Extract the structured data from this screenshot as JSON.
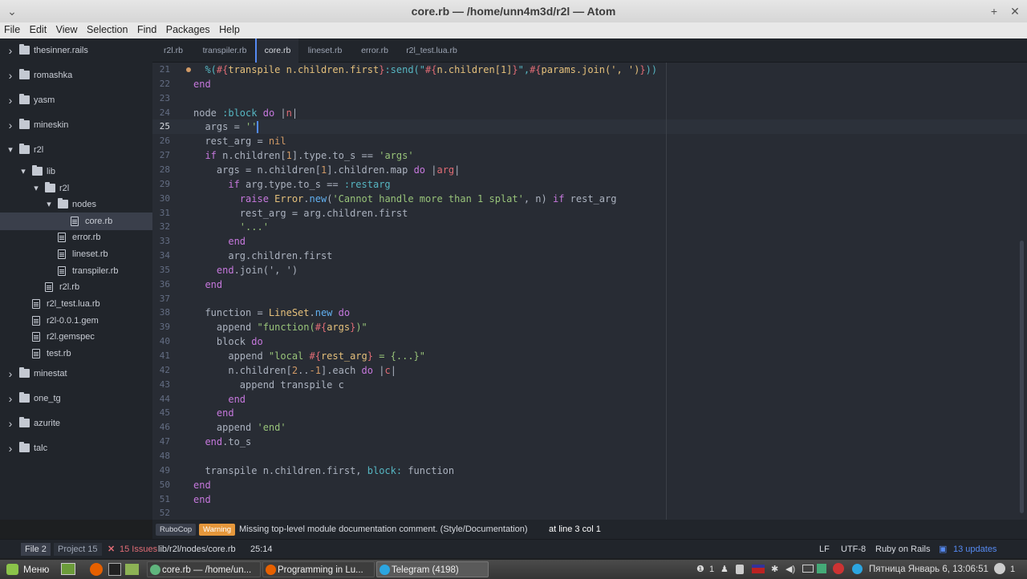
{
  "window": {
    "title": "core.rb — /home/unn4m3d/r2l — Atom",
    "add": "+",
    "close": "✕"
  },
  "menu": [
    "File",
    "Edit",
    "View",
    "Selection",
    "Find",
    "Packages",
    "Help"
  ],
  "tree": [
    {
      "label": "thesinner.rails",
      "type": "folder",
      "open": false
    },
    {
      "label": "romashka",
      "type": "folder",
      "open": false
    },
    {
      "label": "yasm",
      "type": "folder",
      "open": false
    },
    {
      "label": "mineskin",
      "type": "folder",
      "open": false
    },
    {
      "label": "r2l",
      "type": "folder",
      "open": true
    },
    {
      "label": "lib",
      "type": "folder",
      "open": true
    },
    {
      "label": "r2l",
      "type": "folder",
      "open": true
    },
    {
      "label": "nodes",
      "type": "folder",
      "open": true
    },
    {
      "label": "core.rb",
      "type": "file",
      "selected": true
    },
    {
      "label": "error.rb",
      "type": "file"
    },
    {
      "label": "lineset.rb",
      "type": "file"
    },
    {
      "label": "transpiler.rb",
      "type": "file"
    },
    {
      "label": "r2l.rb",
      "type": "file"
    },
    {
      "label": "r2l_test.lua.rb",
      "type": "file"
    },
    {
      "label": "r2l-0.0.1.gem",
      "type": "file"
    },
    {
      "label": "r2l.gemspec",
      "type": "file"
    },
    {
      "label": "test.rb",
      "type": "file"
    },
    {
      "label": "minestat",
      "type": "folder",
      "open": false
    },
    {
      "label": "one_tg",
      "type": "folder",
      "open": false
    },
    {
      "label": "azurite",
      "type": "folder",
      "open": false
    },
    {
      "label": "talc",
      "type": "folder",
      "open": false
    }
  ],
  "tabs": [
    {
      "label": "r2l.rb",
      "active": false
    },
    {
      "label": "transpiler.rb",
      "active": false
    },
    {
      "label": "core.rb",
      "active": true
    },
    {
      "label": "lineset.rb",
      "active": false
    },
    {
      "label": "error.rb",
      "active": false
    },
    {
      "label": "r2l_test.lua.rb",
      "active": false
    }
  ],
  "editor": {
    "current_line": 25,
    "lines": [
      {
        "n": "21",
        "marker": true,
        "t": [
          [
            "  %(",
            "y"
          ],
          [
            "#{",
            "r"
          ],
          [
            "transpile n.children.first",
            "c"
          ],
          [
            "}",
            "r"
          ],
          [
            ":send(\"",
            "y"
          ],
          [
            "#{",
            "r"
          ],
          [
            "n.children[1]",
            "c"
          ],
          [
            "}",
            "r"
          ],
          [
            "\",",
            "y"
          ],
          [
            "#{",
            "r"
          ],
          [
            "params.join(', ')",
            "c"
          ],
          [
            "}",
            "r"
          ],
          [
            "))",
            "y"
          ]
        ]
      },
      {
        "n": "22",
        "t": [
          [
            "end",
            "k"
          ]
        ]
      },
      {
        "n": "23",
        "t": []
      },
      {
        "n": "24",
        "t": [
          [
            "node ",
            ""
          ],
          [
            ":block",
            "y"
          ],
          [
            " ",
            ""
          ],
          [
            "do",
            "k"
          ],
          [
            " |",
            ""
          ],
          [
            "n",
            "r"
          ],
          [
            "|",
            ""
          ]
        ]
      },
      {
        "n": "25",
        "t": [
          [
            "  args = ",
            ""
          ],
          [
            "''",
            "s"
          ]
        ]
      },
      {
        "n": "26",
        "t": [
          [
            "  rest_arg = ",
            ""
          ],
          [
            "nil",
            "n"
          ]
        ]
      },
      {
        "n": "27",
        "t": [
          [
            "  ",
            ""
          ],
          [
            "if",
            "k"
          ],
          [
            " n.children[",
            ""
          ],
          [
            "1",
            "n"
          ],
          [
            "].type.to_s == ",
            ""
          ],
          [
            "'args'",
            "s"
          ]
        ]
      },
      {
        "n": "28",
        "t": [
          [
            "    args = n.children[",
            ""
          ],
          [
            "1",
            "n"
          ],
          [
            "].children.map ",
            ""
          ],
          [
            "do",
            "k"
          ],
          [
            " |",
            ""
          ],
          [
            "arg",
            "r"
          ],
          [
            "|",
            ""
          ]
        ]
      },
      {
        "n": "29",
        "t": [
          [
            "      ",
            ""
          ],
          [
            "if",
            "k"
          ],
          [
            " arg.type.to_s == ",
            ""
          ],
          [
            ":restarg",
            "y"
          ]
        ]
      },
      {
        "n": "30",
        "t": [
          [
            "        ",
            ""
          ],
          [
            "raise",
            "k"
          ],
          [
            " ",
            ""
          ],
          [
            "Error",
            "c"
          ],
          [
            ".",
            ""
          ],
          [
            "new",
            "f"
          ],
          [
            "(",
            ""
          ],
          [
            "'Cannot handle more than 1 splat'",
            "s"
          ],
          [
            ", n) ",
            ""
          ],
          [
            "if",
            "k"
          ],
          [
            " rest_arg",
            ""
          ]
        ]
      },
      {
        "n": "31",
        "t": [
          [
            "        rest_arg = arg.children.first",
            ""
          ]
        ]
      },
      {
        "n": "32",
        "t": [
          [
            "        ",
            ""
          ],
          [
            "'...'",
            "s"
          ]
        ]
      },
      {
        "n": "33",
        "t": [
          [
            "      ",
            ""
          ],
          [
            "end",
            "k"
          ]
        ]
      },
      {
        "n": "34",
        "t": [
          [
            "      arg.children.first",
            ""
          ]
        ]
      },
      {
        "n": "35",
        "t": [
          [
            "    ",
            ""
          ],
          [
            "end",
            "k"
          ],
          [
            ".join(', ')",
            ""
          ]
        ]
      },
      {
        "n": "36",
        "t": [
          [
            "  ",
            ""
          ],
          [
            "end",
            "k"
          ]
        ]
      },
      {
        "n": "37",
        "t": []
      },
      {
        "n": "38",
        "t": [
          [
            "  function = ",
            ""
          ],
          [
            "LineSet",
            "c"
          ],
          [
            ".",
            ""
          ],
          [
            "new",
            "f"
          ],
          [
            " ",
            ""
          ],
          [
            "do",
            "k"
          ]
        ]
      },
      {
        "n": "39",
        "t": [
          [
            "    append ",
            ""
          ],
          [
            "\"function(",
            "s"
          ],
          [
            "#{",
            "r"
          ],
          [
            "args",
            "c"
          ],
          [
            "}",
            "r"
          ],
          [
            ")\"",
            "s"
          ]
        ]
      },
      {
        "n": "40",
        "t": [
          [
            "    block ",
            ""
          ],
          [
            "do",
            "k"
          ]
        ]
      },
      {
        "n": "41",
        "t": [
          [
            "      append ",
            ""
          ],
          [
            "\"local ",
            "s"
          ],
          [
            "#{",
            "r"
          ],
          [
            "rest_arg",
            "c"
          ],
          [
            "}",
            "r"
          ],
          [
            " = {...}\"",
            "s"
          ]
        ]
      },
      {
        "n": "42",
        "t": [
          [
            "      n.children[",
            ""
          ],
          [
            "2",
            "n"
          ],
          [
            "..",
            ""
          ],
          [
            "-1",
            "n"
          ],
          [
            "].each ",
            ""
          ],
          [
            "do",
            "k"
          ],
          [
            " |",
            ""
          ],
          [
            "c",
            "r"
          ],
          [
            "|",
            ""
          ]
        ]
      },
      {
        "n": "43",
        "t": [
          [
            "        append transpile c",
            ""
          ]
        ]
      },
      {
        "n": "44",
        "t": [
          [
            "      ",
            ""
          ],
          [
            "end",
            "k"
          ]
        ]
      },
      {
        "n": "45",
        "t": [
          [
            "    ",
            ""
          ],
          [
            "end",
            "k"
          ]
        ]
      },
      {
        "n": "46",
        "t": [
          [
            "    append ",
            ""
          ],
          [
            "'end'",
            "s"
          ]
        ]
      },
      {
        "n": "47",
        "t": [
          [
            "  ",
            ""
          ],
          [
            "end",
            "k"
          ],
          [
            ".to_s",
            ""
          ]
        ]
      },
      {
        "n": "48",
        "t": []
      },
      {
        "n": "49",
        "t": [
          [
            "  transpile n.children.first, ",
            ""
          ],
          [
            "block:",
            "y"
          ],
          [
            " function",
            ""
          ]
        ]
      },
      {
        "n": "50",
        "t": [
          [
            "end",
            "k"
          ]
        ]
      },
      {
        "n": "51",
        "t": [
          [
            "end",
            "k"
          ]
        ]
      },
      {
        "n": "52",
        "t": []
      }
    ]
  },
  "lint": {
    "source": "RuboCop",
    "level": "Warning",
    "message": "Missing top-level module documentation comment. (Style/Documentation)",
    "location": "at line 3 col 1"
  },
  "status": {
    "file": "File 2",
    "project": "Project 15",
    "issues": "15 Issues",
    "path": "lib/r2l/nodes/core.rb",
    "cursor": "25:14",
    "eol": "LF",
    "encoding": "UTF-8",
    "grammar": "Ruby on Rails",
    "updates": "13 updates"
  },
  "taskbar": {
    "menu": "Меню",
    "windows": [
      {
        "label": "core.rb — /home/un...",
        "active": false
      },
      {
        "label": "Programming in Lu...",
        "active": false
      },
      {
        "label": "Telegram (4198)",
        "active": true
      }
    ],
    "clock": "Пятница Январь  6, 13:06:51",
    "notif": "1",
    "notif2": "1"
  },
  "colors": {
    "accent": "#568af2",
    "warning": "#e5973b",
    "error": "#e06c75",
    "marker": "#d19a66"
  }
}
